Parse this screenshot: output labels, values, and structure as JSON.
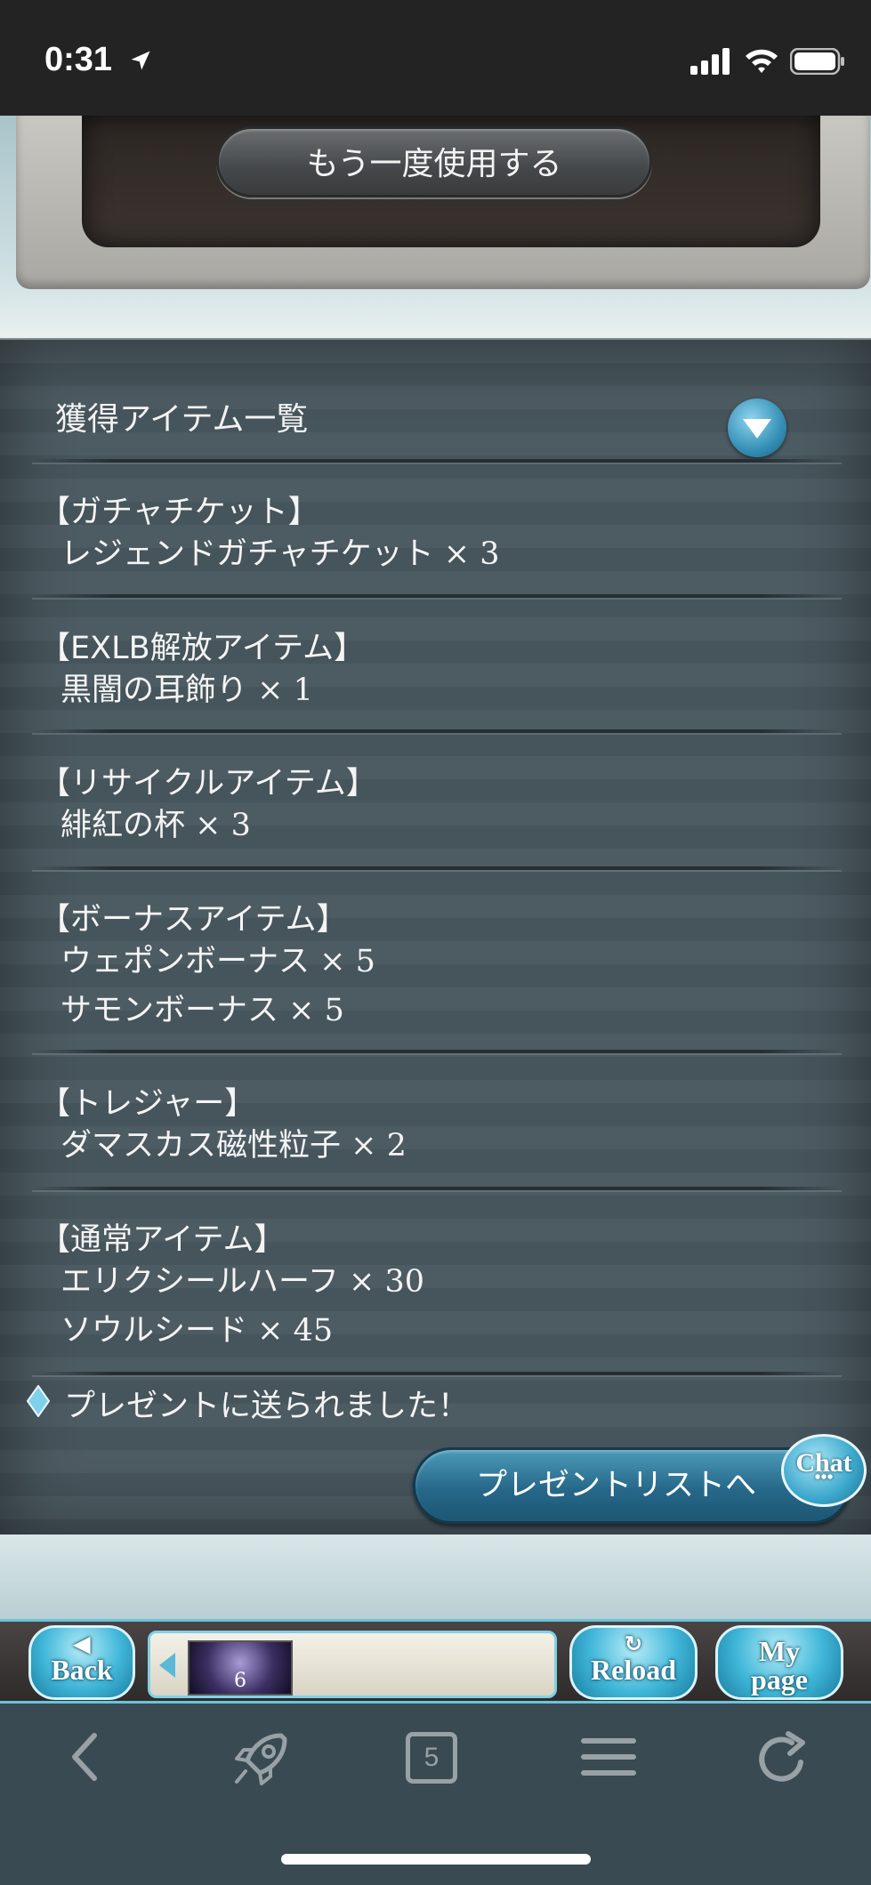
{
  "status_bar": {
    "time": "0:31",
    "icons": [
      "location-arrow-icon",
      "cellular-signal-icon",
      "wifi-icon",
      "battery-icon"
    ]
  },
  "top": {
    "use_again_label": "もう一度使用する"
  },
  "results": {
    "header": "獲得アイテム一覧",
    "toggle_icon": "chevron-down-icon",
    "groups": [
      {
        "category": "【ガチャチケット】",
        "items": [
          {
            "name": "レジェンドガチャチケット",
            "qty": "× 3"
          }
        ]
      },
      {
        "category": "【EXLB解放アイテム】",
        "items": [
          {
            "name": "黒闇の耳飾り",
            "qty": "× 1"
          }
        ]
      },
      {
        "category": "【リサイクルアイテム】",
        "items": [
          {
            "name": "緋紅の杯",
            "qty": "× 3"
          }
        ]
      },
      {
        "category": "【ボーナスアイテム】",
        "items": [
          {
            "name": "ウェポンボーナス",
            "qty": "× 5"
          },
          {
            "name": "サモンボーナス",
            "qty": "× 5"
          }
        ]
      },
      {
        "category": "【トレジャー】",
        "items": [
          {
            "name": "ダマスカス磁性粒子",
            "qty": "× 2"
          }
        ]
      },
      {
        "category": "【通常アイテム】",
        "items": [
          {
            "name": "エリクシールハーフ",
            "qty": "× 30"
          },
          {
            "name": "ソウルシード",
            "qty": "× 45"
          }
        ]
      }
    ],
    "present_note": "プレゼントに送られました！",
    "present_list_button": "プレゼントリストへ",
    "chat_label": "Chat",
    "chat_dots": "•••"
  },
  "game_nav": {
    "back_label": "Back",
    "reload_label": "Reload",
    "mypage_line1": "My",
    "mypage_line2": "page",
    "queue_count": "6"
  },
  "browser_toolbar": {
    "tab_count": "5",
    "icons": [
      "back-chevron-icon",
      "rocket-icon",
      "tabs-icon",
      "menu-icon",
      "refresh-icon"
    ]
  },
  "colors": {
    "panel": "#4d5b62",
    "accent_blue": "#3aa6cb",
    "text": "#f4f4f4"
  }
}
